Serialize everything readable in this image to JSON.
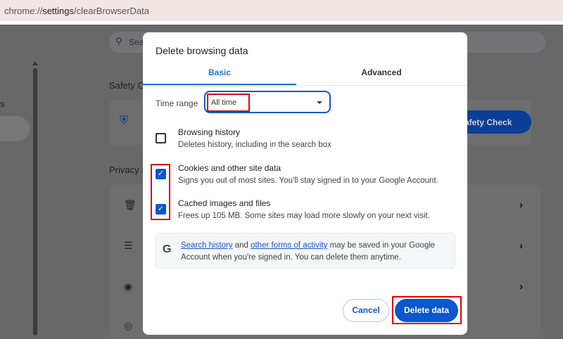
{
  "address_bar": {
    "scheme": "chrome://",
    "host": "settings",
    "path": "/clearBrowserData"
  },
  "background": {
    "search_placeholder": "Sear",
    "left_text": "s",
    "safety_heading": "Safety C",
    "safety_button": "Safety Check",
    "privacy_heading": "Privacy a"
  },
  "dialog": {
    "title": "Delete browsing data",
    "tabs": [
      {
        "label": "Basic",
        "active": true
      },
      {
        "label": "Advanced",
        "active": false
      }
    ],
    "time_range_label": "Time range",
    "time_range_value": "All time",
    "items": [
      {
        "title": "Browsing history",
        "desc": "Deletes history, including in the search box",
        "checked": false
      },
      {
        "title": "Cookies and other site data",
        "desc": "Signs you out of most sites. You'll stay signed in to your Google Account.",
        "checked": true
      },
      {
        "title": "Cached images and files",
        "desc": "Frees up 105 MB. Some sites may load more slowly on your next visit.",
        "checked": true
      }
    ],
    "info": {
      "link1": "Search history",
      "and": " and ",
      "link2": "other forms of activity",
      "rest": " may be saved in your Google Account when you're signed in. You can delete them anytime."
    },
    "cancel_label": "Cancel",
    "delete_label": "Delete data"
  },
  "colors": {
    "accent": "#0b57d0",
    "highlight": "#e00000"
  }
}
